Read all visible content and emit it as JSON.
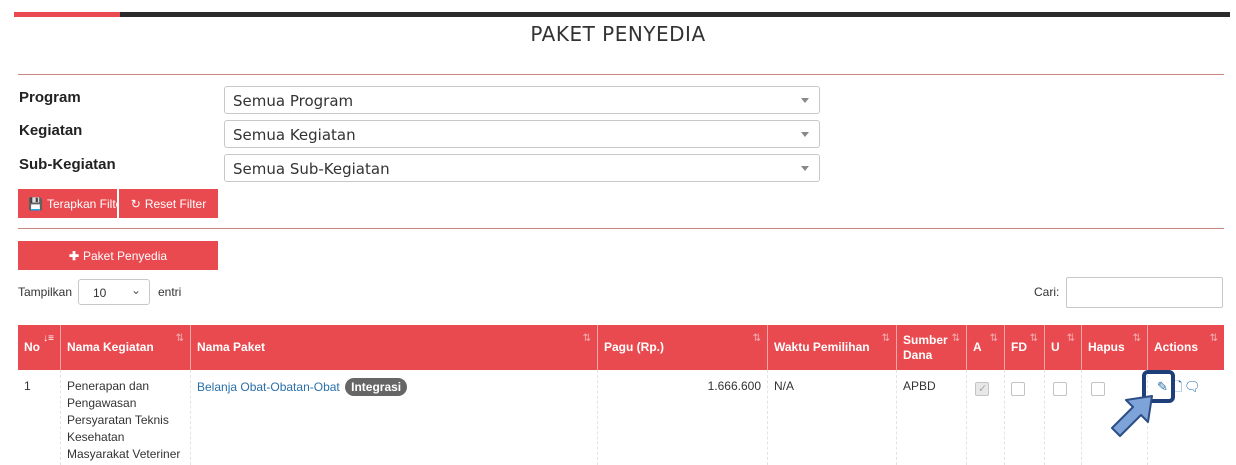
{
  "page": {
    "title": "PAKET PENYEDIA"
  },
  "filters": [
    {
      "label": "Program",
      "value": "Semua Program"
    },
    {
      "label": "Kegiatan",
      "value": "Semua Kegiatan"
    },
    {
      "label": "Sub-Kegiatan",
      "value": "Semua Sub-Kegiatan"
    }
  ],
  "buttons": {
    "apply_filter": "Terapkan Filter",
    "reset_filter": "Reset Filter",
    "add_package": "Paket Penyedia"
  },
  "table_controls": {
    "length_label": "Tampilkan",
    "length_value": "10",
    "length_suffix": "entri",
    "search_label": "Cari:"
  },
  "table": {
    "columns": [
      "No",
      "Nama Kegiatan",
      "Nama Paket",
      "Pagu (Rp.)",
      "Waktu Pemilihan",
      "Sumber Dana",
      "A",
      "FD",
      "U",
      "Hapus",
      "Actions"
    ],
    "rows": [
      {
        "no": "1",
        "nama_kegiatan": "Penerapan dan Pengawasan Persyaratan Teknis Kesehatan Masyarakat Veteriner",
        "nama_paket": "Belanja Obat-Obatan-Obat",
        "badge": "Integrasi",
        "pagu": "1.666.600",
        "waktu_pemilihan": "N/A",
        "sumber_dana": "APBD",
        "a_checked": true,
        "fd_checked": false,
        "u_checked": false,
        "hapus_checked": false
      }
    ]
  },
  "icons": {
    "edit": "edit-icon",
    "document": "document-icon",
    "comment": "comment-icon",
    "pointer": "pointer-arrow-icon"
  },
  "colors": {
    "accent": "#e84a4f",
    "link": "#2a6fa8",
    "highlight": "#1f3f7a",
    "pointer": "#7ea3d8"
  }
}
